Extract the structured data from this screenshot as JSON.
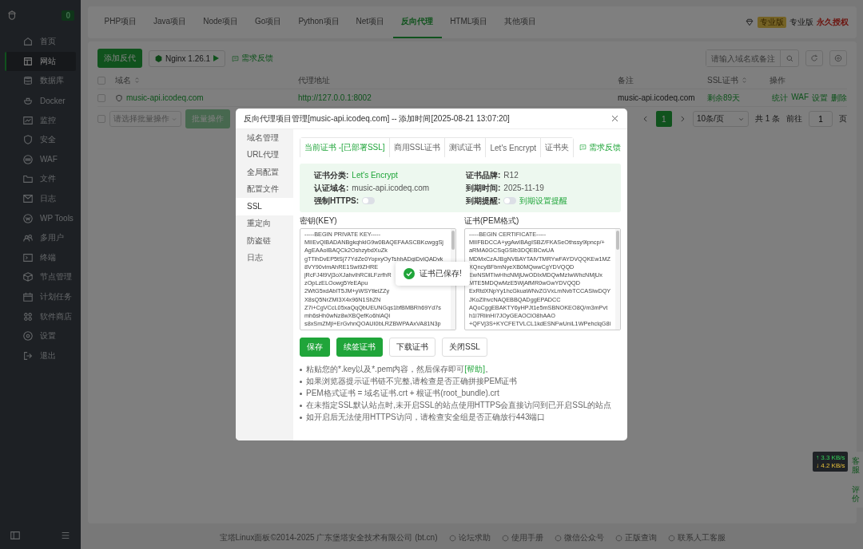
{
  "sidebar": {
    "badge": "0",
    "items": [
      {
        "label": "首页",
        "selected": false
      },
      {
        "label": "网站",
        "selected": true
      },
      {
        "label": "数据库",
        "selected": false
      },
      {
        "label": "Docker",
        "selected": false
      },
      {
        "label": "监控",
        "selected": false
      },
      {
        "label": "安全",
        "selected": false
      },
      {
        "label": "WAF",
        "selected": false
      },
      {
        "label": "文件",
        "selected": false
      },
      {
        "label": "日志",
        "selected": false
      },
      {
        "label": "WP Tools",
        "selected": false
      },
      {
        "label": "多用户",
        "selected": false
      },
      {
        "label": "终端",
        "selected": false
      },
      {
        "label": "节点管理",
        "selected": false
      },
      {
        "label": "计划任务",
        "selected": false
      },
      {
        "label": "软件商店",
        "selected": false
      },
      {
        "label": "设置",
        "selected": false
      },
      {
        "label": "退出",
        "selected": false
      }
    ]
  },
  "project_tabs": [
    {
      "label": "PHP项目",
      "selected": false
    },
    {
      "label": "Java项目",
      "selected": false
    },
    {
      "label": "Node项目",
      "selected": false
    },
    {
      "label": "Go项目",
      "selected": false
    },
    {
      "label": "Python项目",
      "selected": false
    },
    {
      "label": "Net项目",
      "selected": false
    },
    {
      "label": "反向代理",
      "selected": true
    },
    {
      "label": "HTML项目",
      "selected": false
    },
    {
      "label": "其他项目",
      "selected": false
    }
  ],
  "edition": {
    "badge": "专业版",
    "label": "专业版",
    "license": "永久授权"
  },
  "toolbar": {
    "add_button": "添加反代",
    "nginx": "Nginx 1.26.1",
    "feedback": "需求反馈",
    "search": {
      "placeholder": "请输入域名或备注"
    }
  },
  "table": {
    "header_checked": false,
    "columns": [
      {
        "label": "域名",
        "sortable": true
      },
      {
        "label": "代理地址",
        "sortable": false
      },
      {
        "label": "备注",
        "sortable": false
      },
      {
        "label": "SSL证书",
        "sortable": true
      },
      {
        "label": "操作",
        "sortable": false
      }
    ],
    "rows": [
      {
        "checked": false,
        "domain": "music-api.icodeq.com",
        "proxy": "http://127.0.0.1:8002",
        "note": "music-api.icodeq.com",
        "ssl": "剩余89天",
        "actions": [
          "统计",
          "WAF",
          "设置",
          "删除"
        ]
      }
    ]
  },
  "batch": {
    "checked": false,
    "placeholder": "请选择批量操作",
    "button": "批量操作"
  },
  "pagination": {
    "pages": [
      {
        "label": "1",
        "selected": true
      }
    ],
    "page_size": "10条/页",
    "total": "共 1 条",
    "goto": "前往",
    "goto_value": "1",
    "unit": "页"
  },
  "footer": {
    "copyright": "宝塔Linux面板©2014-2025 广东堡塔安全技术有限公司 (bt.cn)",
    "links": [
      "论坛求助",
      "使用手册",
      "微信公众号",
      "正版查询",
      "联系人工客服"
    ]
  },
  "net_speed": {
    "up": "↑ 3.3 KB/s",
    "down": "↓ 4.2 KB/s"
  },
  "side_tabs": [
    "客服",
    "评价"
  ],
  "modal": {
    "title": "反向代理项目管理[music-api.icodeq.com] -- 添加时间[2025-08-21 13:07:20]",
    "menu": [
      {
        "label": "域名管理",
        "selected": false
      },
      {
        "label": "URL代理",
        "selected": false
      },
      {
        "label": "全局配置",
        "selected": false
      },
      {
        "label": "配置文件",
        "selected": false
      },
      {
        "label": "SSL",
        "selected": true
      },
      {
        "label": "重定向",
        "selected": false
      },
      {
        "label": "防盗链",
        "selected": false
      },
      {
        "label": "日志",
        "selected": false
      }
    ],
    "tabs": [
      {
        "label": "当前证书 -[已部署SSL]",
        "selected": true
      },
      {
        "label": "商用SSL证书",
        "selected": false
      },
      {
        "label": "测试证书",
        "selected": false
      },
      {
        "label": "Let's Encrypt",
        "selected": false
      },
      {
        "label": "证书夹",
        "selected": false
      }
    ],
    "feedback": "需求反馈",
    "info": [
      {
        "kind": "text",
        "label": "证书分类:",
        "value": "Let's Encrypt",
        "highlight": true
      },
      {
        "kind": "text",
        "label": "证书品牌:",
        "value": "R12",
        "highlight": false
      },
      {
        "kind": "text",
        "label": "认证域名:",
        "value": "music-api.icodeq.com",
        "highlight": false
      },
      {
        "kind": "text",
        "label": "到期时间:",
        "value": "2025-11-19",
        "highlight": false
      },
      {
        "kind": "toggle",
        "label": "强制HTTPS:",
        "on": false
      },
      {
        "kind": "toggle",
        "label": "到期提醒:",
        "on": false,
        "link": "到期设置提醒"
      }
    ],
    "key": {
      "label": "密钥(KEY)",
      "lines": [
        "-----BEGIN PRIVATE KEY-----",
        "MIIEvQIBADANBgkqhkiG9w0BAQEFAASCBKcwggSj",
        "AgEAAoIBAQCk2OshzybdXuZk",
        "gTTihDvEP5tSj77YdZe0YopxyOyTshhADgiDvIQADvk",
        "8VY90vimAhRE1Swi9ZHRE",
        "jRcFJ4l9Vj3oXJahvlhRCiiLFzrfhR",
        "zOpLzELOowg5YeEApu",
        "2WtG5xdAbIT5JM+yWSYtleiZZy",
        "X8sQ5NrZMI3X4x96N1ShZN",
        "Z7i+CgVCcL05xaQqQbUEUNGqs1bfBMBRh69Yd7s",
        "mh6sHh0wNz8wXBQefKo6hlAQi",
        "s8xSmZMjl+ErGvhnQOAUI0bLRZBWPAAxVA81N3p"
      ]
    },
    "cert": {
      "label": "证书(PEM格式)",
      "lines": [
        "-----BEGIN CERTIFICATE-----",
        "MIIFBDCCA+ygAwIBAgISBZ/FKASeOthssy9lpncp/+",
        "aRMA0GCSqGSIb3DQEBCwUA",
        "MDMxCzAJBgNVBAYTAlVTMRYwFAYDVQQKEw1MZ",
        "XQncyBFbmNyeXB0MQwwCgYDVQQD",
        "EwNSMTIwHhcNMjUwODIxMDQwMzIwWhcNMjUx",
        "MTE5MDQwMzE5WjAfMR0wGwYDVQQD",
        "ExRtdXNpYy1hcGkuaWNvZGVxLmNvbTCCASIwDQY",
        "JKoZIhvcNAQEBBQADggEPADCC",
        "AQoCggEBAKTY6yHPJt1e5mSBNOKEO8Q/m3mPvt",
        "h1l7RiinHI7JOyGEAOClO8hAAO",
        "+QFVj3S+KYCFETVLCL1kdESNFwUniL1WPehclqG8i"
      ]
    },
    "buttons": [
      {
        "label": "保存",
        "kind": "primary"
      },
      {
        "label": "续签证书",
        "kind": "primary"
      },
      {
        "label": "下载证书",
        "kind": "plain"
      },
      {
        "label": "关闭SSL",
        "kind": "plain"
      }
    ],
    "notes": [
      {
        "text": "粘贴您的*.key以及*.pem内容，然后保存即可",
        "link": "[帮助]",
        "tail": "。"
      },
      {
        "text": "如果浏览器提示证书链不完整,请检查是否正确拼接PEM证书"
      },
      {
        "text": "PEM格式证书 = 域名证书.crt + 根证书(root_bundle).crt"
      },
      {
        "text": "在未指定SSL默认站点时,未开启SSL的站点使用HTTPS会直接访问到已开启SSL的站点"
      },
      {
        "text": "如开启后无法使用HTTPS访问，请检查安全组是否正确放行443端口"
      }
    ],
    "toast": "证书已保存!"
  }
}
